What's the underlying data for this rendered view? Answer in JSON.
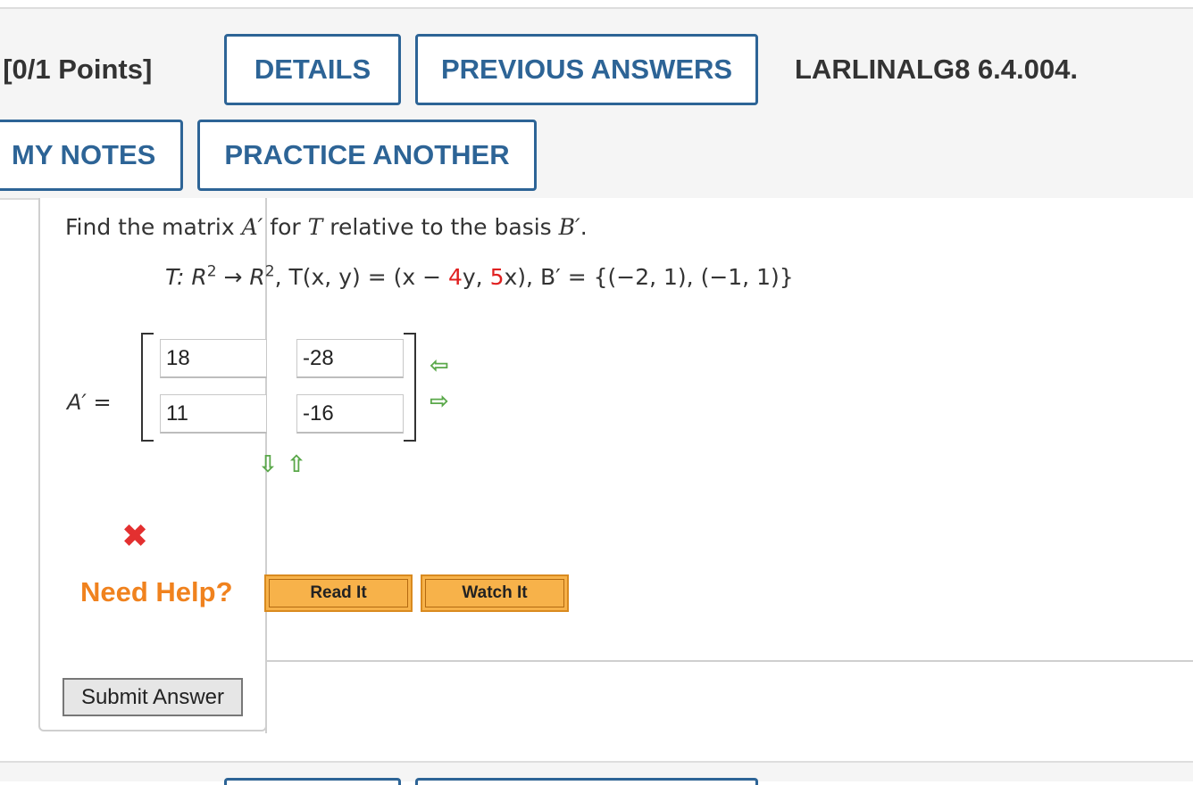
{
  "header": {
    "question_points": ". [0/1 Points]",
    "details_label": "DETAILS",
    "previous_answers_label": "PREVIOUS ANSWERS",
    "question_id": "LARLINALG8 6.4.004.",
    "my_notes_label": "MY NOTES",
    "practice_another_label": "PRACTICE ANOTHER"
  },
  "problem": {
    "prompt_pre": "Find the matrix ",
    "prompt_A": "A′",
    "prompt_mid": " for ",
    "prompt_T": "T",
    "prompt_mid2": " relative to the basis ",
    "prompt_B": "B′",
    "prompt_end": ".",
    "eq_part1": "T: R",
    "eq_sup1": "2",
    "eq_part2": " → R",
    "eq_sup2": "2",
    "eq_part3": ", T(x, y) = (x − ",
    "eq_coef1": "4",
    "eq_part4": "y, ",
    "eq_coef2": "5",
    "eq_part5": "x), B′ = {(−2, 1), (−1, 1)}"
  },
  "matrix": {
    "label": "A′ =",
    "r0c0": "18",
    "r0c1": "-28",
    "r1c0": "11",
    "r1c1": "-16"
  },
  "help": {
    "need_help": "Need Help?",
    "read_it": "Read It",
    "watch_it": "Watch It"
  },
  "submit_label": "Submit Answer",
  "colors": {
    "accent_blue": "#2d6496",
    "error_red": "#e33030",
    "arrow_green": "#5aa84a",
    "help_orange": "#f0821e"
  },
  "icons": [
    "arrow-left-icon",
    "arrow-right-icon",
    "arrow-down-icon",
    "arrow-up-icon",
    "incorrect-x-icon"
  ]
}
